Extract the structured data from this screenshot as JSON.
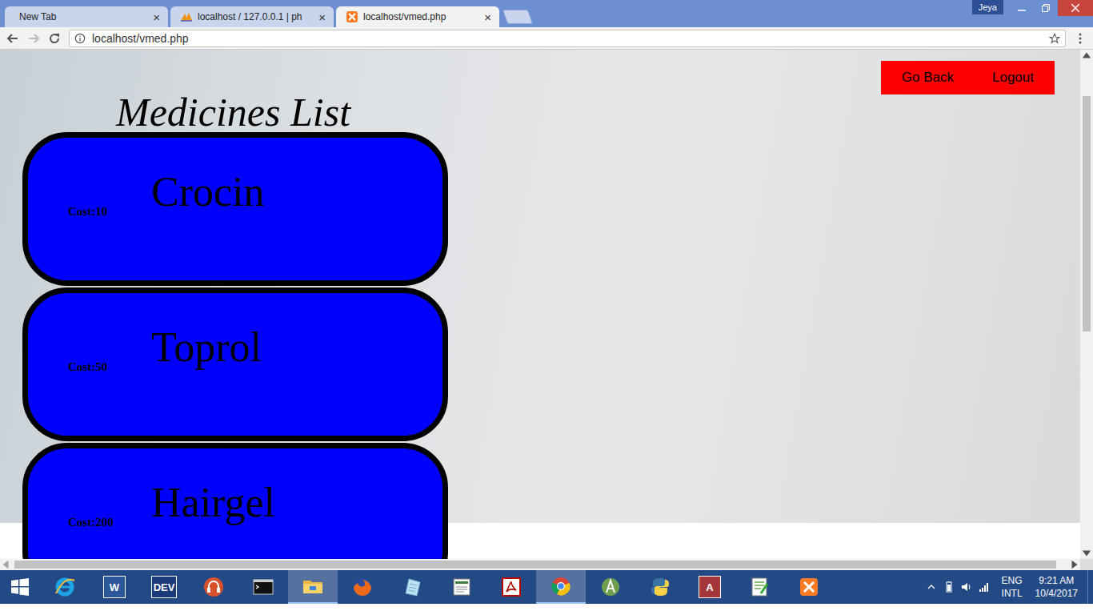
{
  "browser": {
    "tabs": [
      {
        "label": "New Tab",
        "favicon": "none",
        "close": "×",
        "selected": false
      },
      {
        "label": "localhost / 127.0.0.1 | ph",
        "favicon": "pma",
        "close": "×",
        "selected": false
      },
      {
        "label": "localhost/vmed.php",
        "favicon": "xampp",
        "close": "×",
        "selected": true
      }
    ],
    "profile": "Jeya",
    "address": "localhost/vmed.php"
  },
  "page": {
    "title": "Medicines List",
    "nav": [
      "Go Back",
      "Logout"
    ],
    "medicines": [
      {
        "name": "Crocin",
        "cost": "Cost:10"
      },
      {
        "name": "Toprol",
        "cost": "Cost:50"
      },
      {
        "name": "Hairgel",
        "cost": "Cost:200"
      }
    ]
  },
  "taskbar": {
    "apps": [
      {
        "kind": "ie",
        "active": false
      },
      {
        "kind": "word",
        "label": "W",
        "active": false
      },
      {
        "kind": "devcpp",
        "label": "DEV",
        "active": false
      },
      {
        "kind": "music",
        "active": false
      },
      {
        "kind": "cmd",
        "active": false
      },
      {
        "kind": "explorer",
        "active": true
      },
      {
        "kind": "firefox",
        "active": false
      },
      {
        "kind": "notepad",
        "active": false
      },
      {
        "kind": "doc",
        "active": false
      },
      {
        "kind": "acrobat",
        "active": false
      },
      {
        "kind": "chrome",
        "active": true
      },
      {
        "kind": "android",
        "active": false
      },
      {
        "kind": "python",
        "active": false
      },
      {
        "kind": "access",
        "label": "A",
        "active": false
      },
      {
        "kind": "notepadpp",
        "active": false
      },
      {
        "kind": "xampp",
        "active": false
      }
    ],
    "tray": {
      "language": "ENG",
      "layout": "INTL",
      "time": "9:21 AM",
      "date": "10/4/2017"
    }
  }
}
